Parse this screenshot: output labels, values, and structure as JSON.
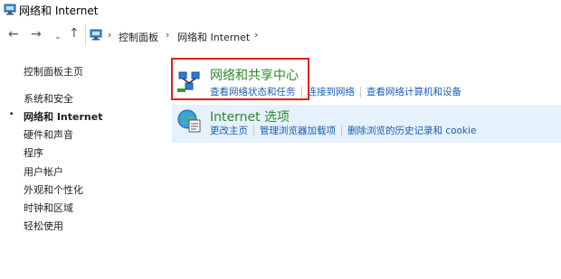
{
  "window": {
    "title": "网络和 Internet"
  },
  "nav": {
    "back_icon": "←",
    "forward_icon": "→",
    "dropdown_icon": "⌄",
    "up_icon": "↑",
    "separator": "›",
    "breadcrumbs": [
      "控制面板",
      "网络和 Internet"
    ]
  },
  "sidebar": {
    "home": "控制面板主页",
    "items": [
      {
        "label": "系统和安全",
        "active": false
      },
      {
        "label": "网络和 Internet",
        "active": true
      },
      {
        "label": "硬件和声音",
        "active": false
      },
      {
        "label": "程序",
        "active": false
      },
      {
        "label": "用户帐户",
        "active": false
      },
      {
        "label": "外观和个性化",
        "active": false
      },
      {
        "label": "时钟和区域",
        "active": false
      },
      {
        "label": "轻松使用",
        "active": false
      }
    ],
    "bullet": "•"
  },
  "categories": [
    {
      "title": "网络和共享中心",
      "icon": "network-center-icon",
      "links": [
        "查看网络状态和任务",
        "连接到网络",
        "查看网络计算机和设备"
      ]
    },
    {
      "title": "Internet 选项",
      "icon": "internet-options-icon",
      "links": [
        "更改主页",
        "管理浏览器加载项",
        "删除浏览的历史记录和 cookie"
      ]
    }
  ],
  "colors": {
    "category_title": "#2a8a2a",
    "link": "#1a5fb4",
    "highlight_box": "#e02020",
    "hover_row": "#e5f1fb"
  }
}
